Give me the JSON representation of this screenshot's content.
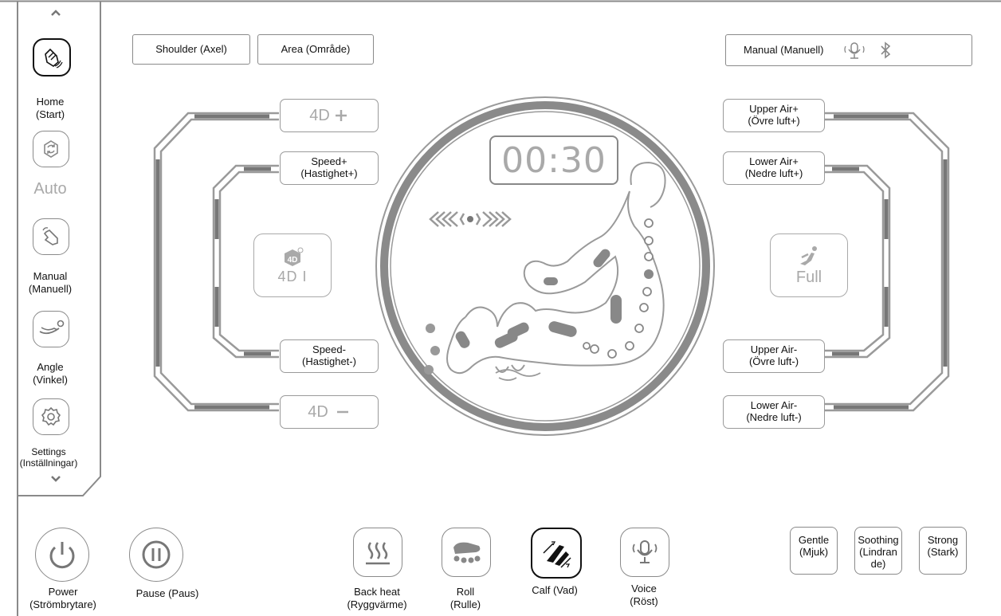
{
  "sidebar": {
    "scroll_up_icon": "chevron-up-icon",
    "scroll_down_icon": "chevron-down-icon",
    "items": [
      {
        "name": "home",
        "label": "Home\n(Start)",
        "icon": "hand-icon",
        "active": true
      },
      {
        "name": "auto",
        "label": "Auto",
        "icon": "sync-icon",
        "active": false
      },
      {
        "name": "manual",
        "label": "Manual\n(Manuell)",
        "icon": "pointing-hand-icon",
        "active": false
      },
      {
        "name": "angle",
        "label": "Angle\n(Vinkel)",
        "icon": "recline-icon",
        "active": false
      },
      {
        "name": "settings",
        "label": "Settings\n(Inställningar)",
        "icon": "gear-icon",
        "active": false
      }
    ]
  },
  "top": {
    "shoulder_label": "Shoulder (Axel)",
    "area_label": "Area (Område)",
    "mode_label": "Manual (Manuell)",
    "voice_icon": "microphone-icon",
    "bluetooth_icon": "bluetooth-icon"
  },
  "left_controls": {
    "fourd_plus": "4D",
    "speed_plus": "Speed+\n(Hastighet+)",
    "speed_minus": "Speed-\n(Hastighet-)",
    "fourd_minus": "4D",
    "mode_box_label": "4D I"
  },
  "right_controls": {
    "upper_air_plus": "Upper Air+\n(Övre luft+)",
    "lower_air_plus": "Lower Air+\n(Nedre luft+)",
    "upper_air_minus": "Upper Air-\n(Övre luft-)",
    "lower_air_minus": "Lower Air-\n(Nedre luft-)",
    "mode_box_label": "Full"
  },
  "center": {
    "timer": "00:30"
  },
  "bottom": {
    "power_label": "Power\n(Strömbrytare)",
    "pause_label": "Pause (Paus)",
    "back_heat_label": "Back heat\n(Ryggvärme)",
    "roll_label": "Roll\n(Rulle)",
    "calf_label": "Calf (Vad)",
    "voice_label": "Voice\n(Röst)",
    "gentle_label": "Gentle\n(Mjuk)",
    "soothing_label": "Soothing\n(Lindran\nde)",
    "strong_label": "Strong\n(Stark)"
  },
  "colors": {
    "frame": "#8a8a8a",
    "inactive": "#a9a9a9",
    "active": "#111111"
  }
}
